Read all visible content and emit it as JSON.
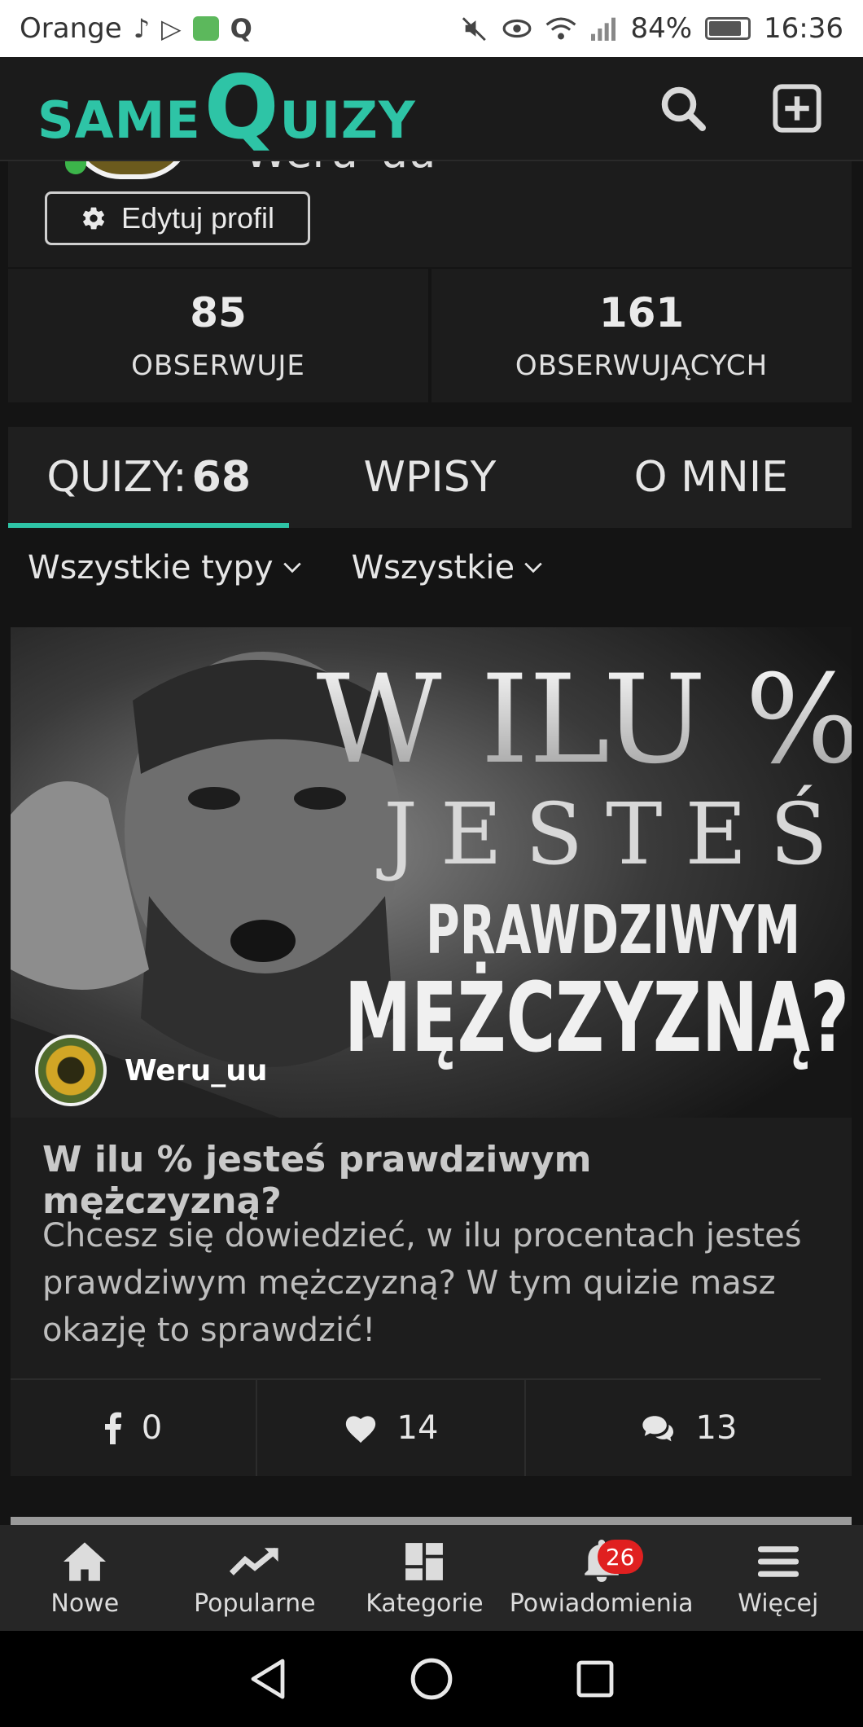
{
  "status_bar": {
    "carrier": "Orange",
    "battery": "84%",
    "battery_level": 0.84,
    "time": "16:36",
    "icons": [
      "tiktok-icon",
      "play-icon",
      "app-icon",
      "quora-icon",
      "mute-icon",
      "eye-icon",
      "wifi-icon",
      "signal-icon",
      "battery-icon"
    ]
  },
  "header": {
    "logo_same": "SAME",
    "logo_q": "Q",
    "logo_uizy": "UIZY",
    "accent_color": "#2ec4a6"
  },
  "profile": {
    "username": "Weru_uu",
    "edit_label": "Edytuj profil"
  },
  "stats": {
    "following_count": "85",
    "following_label": "OBSERWUJE",
    "followers_count": "161",
    "followers_label": "OBSERWUJĄCYCH"
  },
  "tabs": {
    "quizzes_label": "QUIZY:",
    "quizzes_count": "68",
    "posts_label": "WPISY",
    "about_label": "O MNIE"
  },
  "filters": {
    "type_label": "Wszystkie typy",
    "scope_label": "Wszystkie"
  },
  "quiz_card": {
    "image_text_line1": "W ILU %",
    "image_text_line2": "JESTEŚ",
    "image_text_line3": "PRAWDZIWYM",
    "image_text_line4": "MĘŻCZYZNĄ?",
    "author": "Weru_uu",
    "title": "W ilu % jesteś prawdziwym mężczyzną?",
    "description": "Chcesz się dowiedzieć, w ilu procentach jesteś prawdziwym mężczyzną? W tym quizie masz okazję to sprawdzić!",
    "shares": "0",
    "likes": "14",
    "comments": "13"
  },
  "bottom_nav": {
    "new_label": "Nowe",
    "popular_label": "Popularne",
    "categories_label": "Kategorie",
    "notifications_label": "Powiadomienia",
    "notifications_badge": "26",
    "more_label": "Więcej"
  }
}
